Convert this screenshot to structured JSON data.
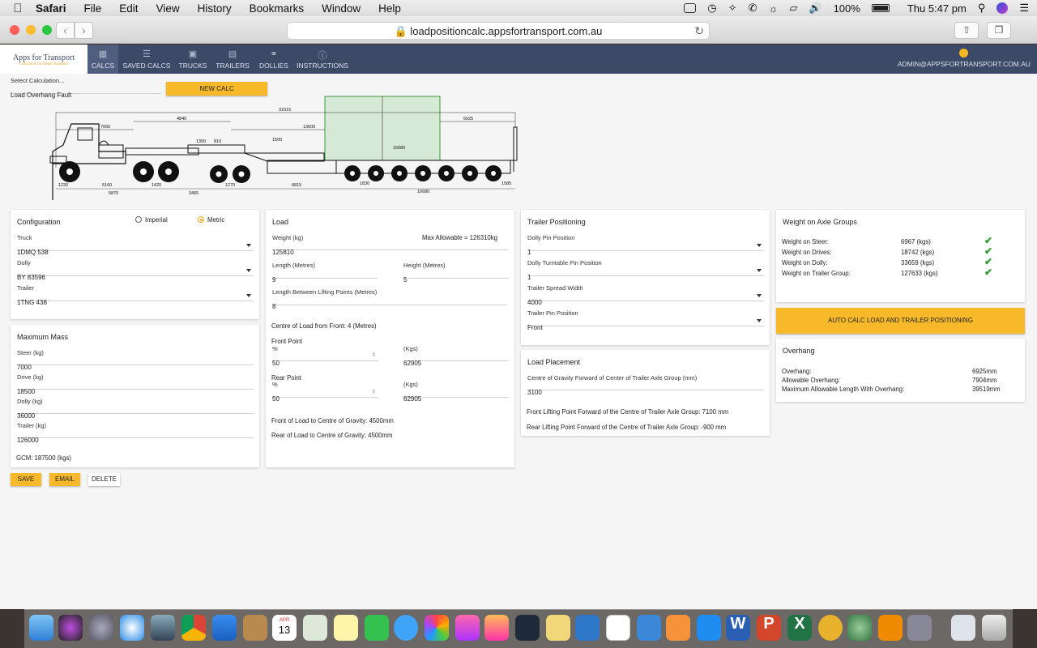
{
  "menubar": {
    "app_name": "Safari",
    "items": [
      "File",
      "Edit",
      "View",
      "History",
      "Bookmarks",
      "Window",
      "Help"
    ],
    "battery": "100%",
    "clock": "Thu 5:47 pm"
  },
  "browser": {
    "url": "loadpositioncalc.appsfortransport.com.au"
  },
  "nav": {
    "logo": "Apps for Transport",
    "logo_tagline": "Calculator for Road Transport",
    "items": [
      "CALCS",
      "SAVED CALCS",
      "TRUCKS",
      "TRAILERS",
      "DOLLIES",
      "INSTRUCTIONS"
    ],
    "user": "ADMIN@APPSFORTRANSPORT.COM.AU"
  },
  "selection": {
    "label": "Select Calculation...",
    "value": "Load Overhang Fault",
    "new_button": "NEW CALC"
  },
  "diagram": {
    "dims_top": [
      "31615",
      "4840",
      "7060",
      "13600",
      "6925",
      "1350",
      "810",
      "1500",
      "16080"
    ],
    "dims_bottom": [
      "1220",
      "5160",
      "1420",
      "5870",
      "3465",
      "1270",
      "6815",
      "1830",
      "10680",
      "1585"
    ]
  },
  "config": {
    "title": "Configuration",
    "unit_imperial": "Imperial",
    "unit_metric": "Metric",
    "truck_label": "Truck",
    "truck_value": "1DMQ 538",
    "dolly_label": "Dolly",
    "dolly_value": "BY 83596",
    "trailer_label": "Trailer",
    "trailer_value": "1TNG 438"
  },
  "maxmass": {
    "title": "Maximum Mass",
    "steer_label": "Steer (kg)",
    "steer_value": "7000",
    "drive_label": "Drive (kg)",
    "drive_value": "18500",
    "dolly_label": "Dolly (kg)",
    "dolly_value": "36000",
    "trailer_label": "Trailer (kg)",
    "trailer_value": "126000",
    "gcm": "GCM: 187500 (kgs)"
  },
  "actions": {
    "save": "SAVE",
    "email": "EMAIL",
    "delete": "DELETE"
  },
  "load": {
    "title": "Load",
    "weight_label": "Weight (kg)",
    "weight_value": "125810",
    "max_allowable": "Max Allowable = 126310kg",
    "length_label": "Length (Metres)",
    "length_value": "9",
    "height_label": "Height (Metres)",
    "height_value": "5",
    "lift_label": "Length Between Lifting Points (Metres)",
    "lift_value": "8",
    "centre_text": "Centre of Load from Front: 4 (Metres)",
    "front_point": "Front Point",
    "pct": "%",
    "kgs": "(Kgs)",
    "front_pct": "50",
    "front_kgs": "62905",
    "rear_point": "Rear Point",
    "rear_pct": "50",
    "rear_kgs": "62905",
    "front_cog": "Front of Load to Centre of Gravity: 4500mm",
    "rear_cog": "Rear of Load to Centre of Gravity: 4500mm"
  },
  "trailer_pos": {
    "title": "Trailer Positioning",
    "dolly_pin_label": "Dolly Pin Position",
    "dolly_pin_value": "1",
    "dolly_turntable_label": "Dolly Turntable Pin Position",
    "dolly_turntable_value": "1",
    "spread_label": "Trailer Spread Width",
    "spread_value": "4000",
    "trailer_pin_label": "Trailer Pin Position",
    "trailer_pin_value": "Front"
  },
  "load_placement": {
    "title": "Load Placement",
    "cog_label": "Centre of Gravity Forward of Center of Trailer Axle Group (mm)",
    "cog_value": "3100",
    "front_lift": "Front Lifting Point Forward of the Centre of Trailer Axle Group: 7100 mm",
    "rear_lift": "Rear Lifting Point Forward of the Centre of Trailer Axle Group: -900 mm"
  },
  "axle_weights": {
    "title": "Weight on Axle Groups",
    "rows": [
      {
        "label": "Weight on Steer:",
        "value": "6967 (kgs)"
      },
      {
        "label": "Weight on Drives:",
        "value": "18742 (kgs)"
      },
      {
        "label": "Weight on Dolly:",
        "value": "33659 (kgs)"
      },
      {
        "label": "Weight on Trailer Group:",
        "value": "127633 (kgs)"
      }
    ]
  },
  "auto_calc": "AUTO CALC LOAD AND TRAILER POSITIONING",
  "overhang": {
    "title": "Overhang",
    "rows": [
      {
        "label": "Overhang:",
        "value": "6925mm"
      },
      {
        "label": "Allowable Overhang:",
        "value": "7904mm"
      },
      {
        "label": "Maximum Allowable Length With Overhang:",
        "value": "39519mm"
      }
    ]
  },
  "dock": {
    "calendar_month": "APR",
    "calendar_day": "13"
  }
}
